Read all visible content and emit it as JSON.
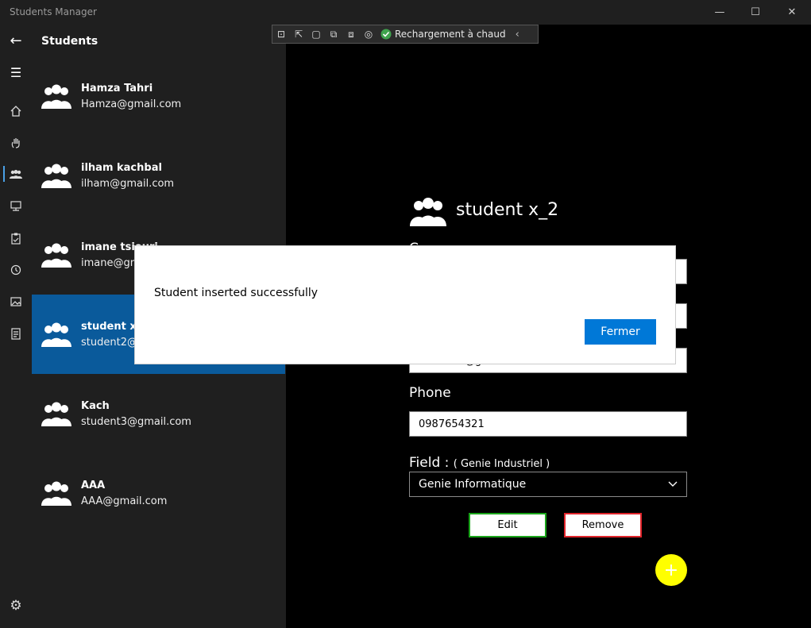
{
  "window": {
    "title": "Students Manager",
    "minimize": "—",
    "maximize": "☐",
    "close": "✕"
  },
  "sidebar": {
    "back": "←",
    "menu": "☰",
    "settings": "⚙",
    "nav_icons": [
      "home-icon",
      "hand-icon",
      "people-icon",
      "network-icon",
      "clipboard-icon",
      "history-icon",
      "gallery-icon",
      "checklist-icon"
    ]
  },
  "list": {
    "title": "Students",
    "items": [
      {
        "name": "Hamza Tahri",
        "email": "Hamza@gmail.com"
      },
      {
        "name": "ilham kachbal",
        "email": "ilham@gmail.com"
      },
      {
        "name": "imane tsiouri",
        "email": "imane@gmail.com"
      },
      {
        "name": "student x_2",
        "email": "student2@gmail.com"
      },
      {
        "name": "Kach",
        "email": "student3@gmail.com"
      },
      {
        "name": "AAA",
        "email": "AAA@gmail.com"
      }
    ]
  },
  "devtools": {
    "hot_reload": "Rechargement à chaud",
    "collapse": "‹"
  },
  "detail": {
    "name": "student x_2",
    "partial_label": "C",
    "email_value": "student2@gmail.com",
    "phone_label": "Phone",
    "phone_value": "0987654321",
    "field_label": "Field :",
    "field_current": "( Genie Industriel )",
    "field_selected": "Genie Informatique",
    "edit": "Edit",
    "remove": "Remove",
    "fab": "+"
  },
  "dialog": {
    "message": "Student inserted successfully",
    "button": "Fermer"
  },
  "colors": {
    "accent": "#0078d7",
    "selected": "#0a5a9b",
    "fab": "#ffff00",
    "edit_border": "#1aa51a",
    "remove_border": "#e0242b"
  }
}
